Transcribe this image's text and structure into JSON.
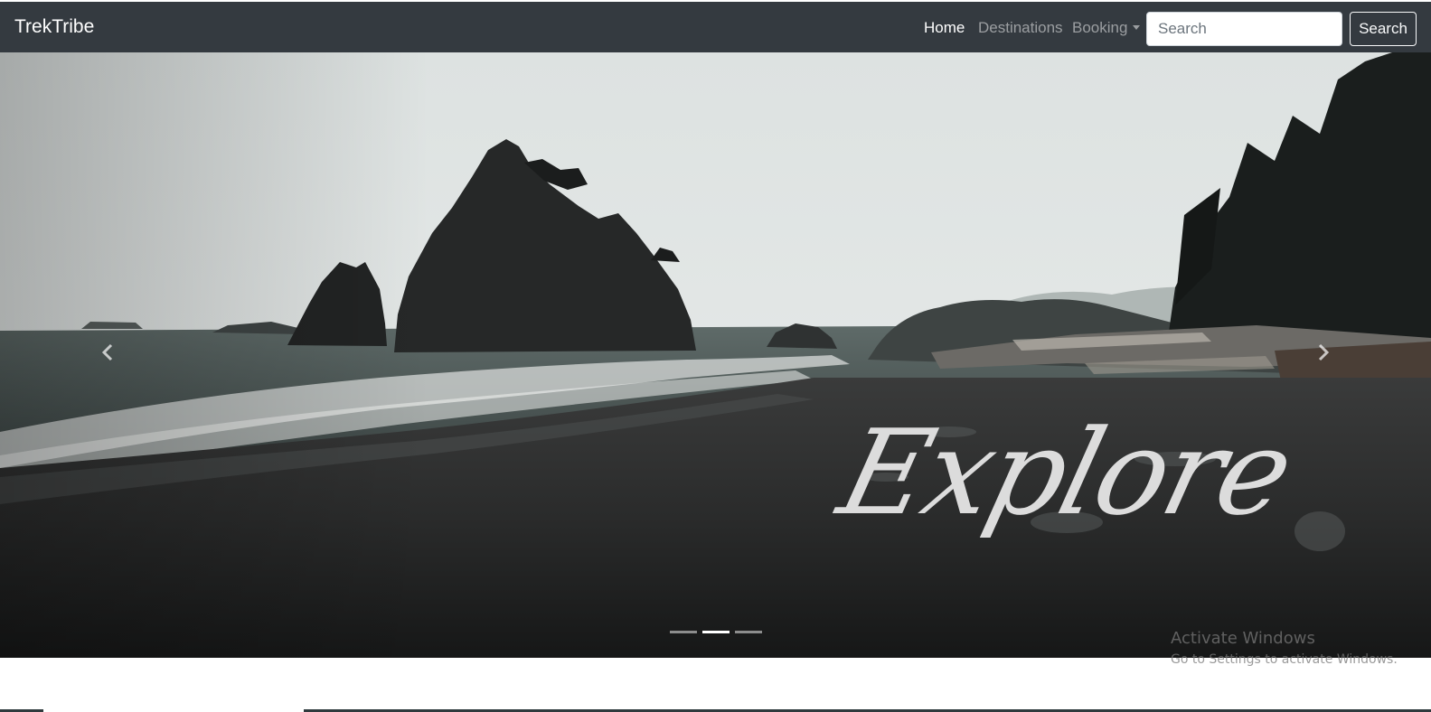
{
  "navbar": {
    "brand": "TrekTribe",
    "links": [
      {
        "label": "Home",
        "active": true
      },
      {
        "label": "Destinations",
        "active": false
      },
      {
        "label": "Booking",
        "active": false,
        "dropdown": true
      }
    ],
    "search_placeholder": "Search",
    "search_button": "Search"
  },
  "carousel": {
    "caption": "Explore",
    "slide_count": 3,
    "active_slide": 2,
    "prev_icon": "chevron-left-icon",
    "next_icon": "chevron-right-icon"
  },
  "windows_watermark": {
    "title": "Activate Windows",
    "subtitle": "Go to Settings to activate Windows."
  },
  "colors": {
    "navbar_bg": "#343a40",
    "nav_active": "#ffffff",
    "nav_inactive": "rgba(255,255,255,0.5)",
    "caption": "#dcdcdc"
  }
}
